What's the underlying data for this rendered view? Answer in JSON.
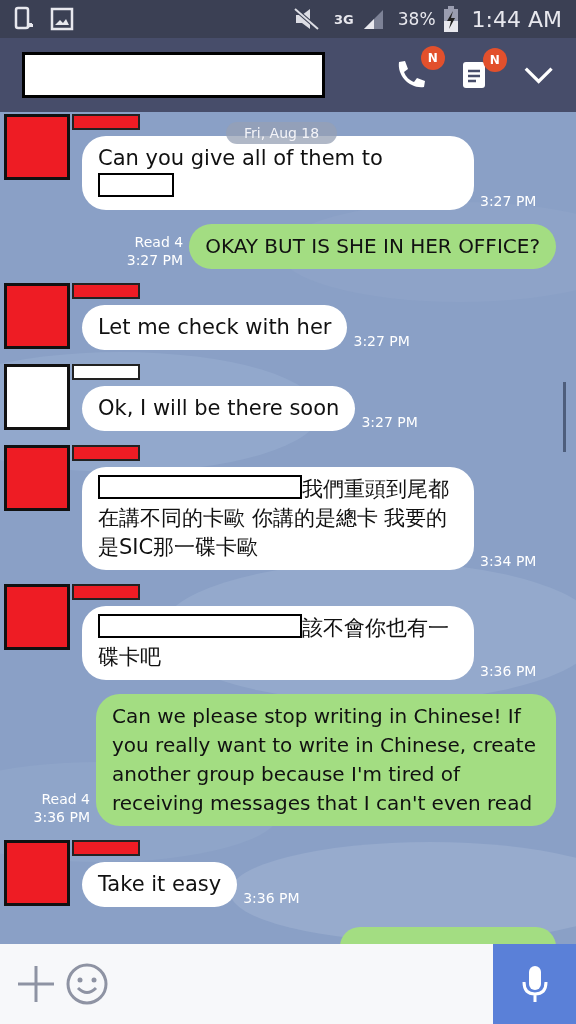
{
  "status_bar": {
    "battery": "38%",
    "time": "1:44 AM",
    "network": "3G"
  },
  "header": {
    "badges": [
      "N",
      "N"
    ]
  },
  "date_label": "Fri, Aug 18",
  "messages": [
    {
      "kind": "in",
      "color": "#ee1c24",
      "text": "Can you give all of them to",
      "redacted_before": false,
      "redacted_after": true,
      "time": "3:27 PM"
    },
    {
      "kind": "out",
      "read": "Read 4",
      "time": "3:27 PM",
      "text": "OKAY BUT IS SHE IN HER OFFICE?"
    },
    {
      "kind": "in",
      "color": "#ee1c24",
      "text": "Let me check with her",
      "redacted_before": false,
      "redacted_after": false,
      "time": "3:27 PM"
    },
    {
      "kind": "in",
      "color": "#ffffff",
      "text": "Ok, I will be there soon",
      "redacted_before": false,
      "redacted_after": false,
      "time": "3:27 PM"
    },
    {
      "kind": "in",
      "color": "#ee1c24",
      "text": "我們重頭到尾都在講不同的卡歐 你講的是總卡 我要的是SIC那一碟卡歐",
      "redacted_before": true,
      "redacted_after": false,
      "time": "3:34 PM"
    },
    {
      "kind": "in",
      "color": "#ee1c24",
      "text": "該不會你也有一碟卡吧",
      "redacted_before": true,
      "redacted_after": false,
      "time": "3:36 PM"
    },
    {
      "kind": "out",
      "read": "Read 4",
      "time": "3:36 PM",
      "text": "Can we please stop writing in Chinese! If you really want to write in Chinese, create another group because I'm tired of receiving messages that I can't even read"
    },
    {
      "kind": "in",
      "color": "#ee1c24",
      "text": "Take it easy",
      "redacted_before": false,
      "redacted_after": false,
      "time": "3:36 PM"
    },
    {
      "kind": "out_cut"
    }
  ]
}
